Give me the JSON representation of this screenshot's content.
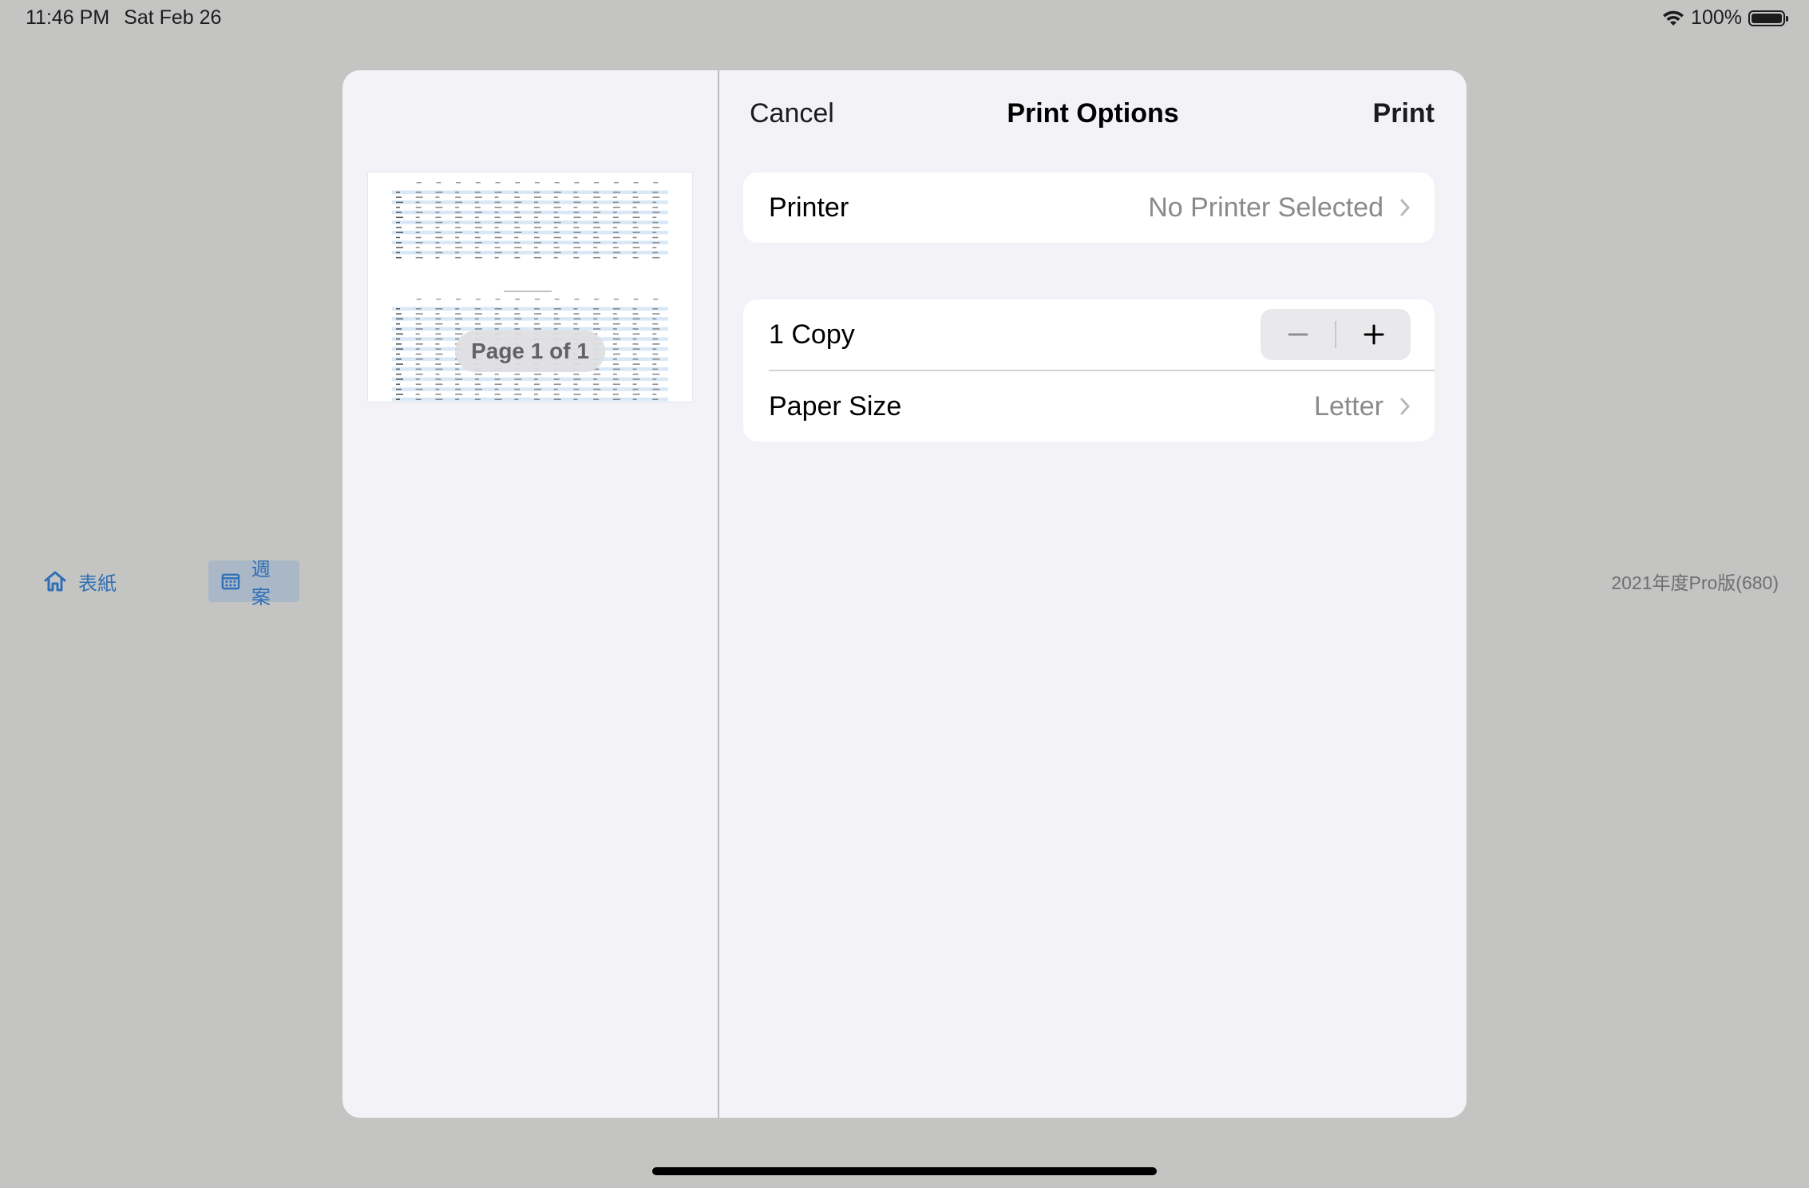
{
  "status_bar": {
    "time": "11:46 PM",
    "date": "Sat Feb 26",
    "battery": "100%",
    "battery_level": 1.0
  },
  "background_app": {
    "tabs": [
      {
        "label": "表紙",
        "icon": "home-icon"
      },
      {
        "label": "週案",
        "icon": "calendar-icon"
      }
    ],
    "version": "2021年度Pro版(680)"
  },
  "print_dialog": {
    "cancel_label": "Cancel",
    "title": "Print Options",
    "print_label": "Print",
    "page_indicator": "Page 1 of 1",
    "printer": {
      "label": "Printer",
      "value": "No Printer Selected"
    },
    "copies": {
      "label": "1 Copy"
    },
    "paper_size": {
      "label": "Paper Size",
      "value": "Letter"
    }
  },
  "colors": {
    "backdrop": "#c4c5c3",
    "sheet": "#f2f2f7",
    "accent_blue": "#2f6fb5"
  }
}
